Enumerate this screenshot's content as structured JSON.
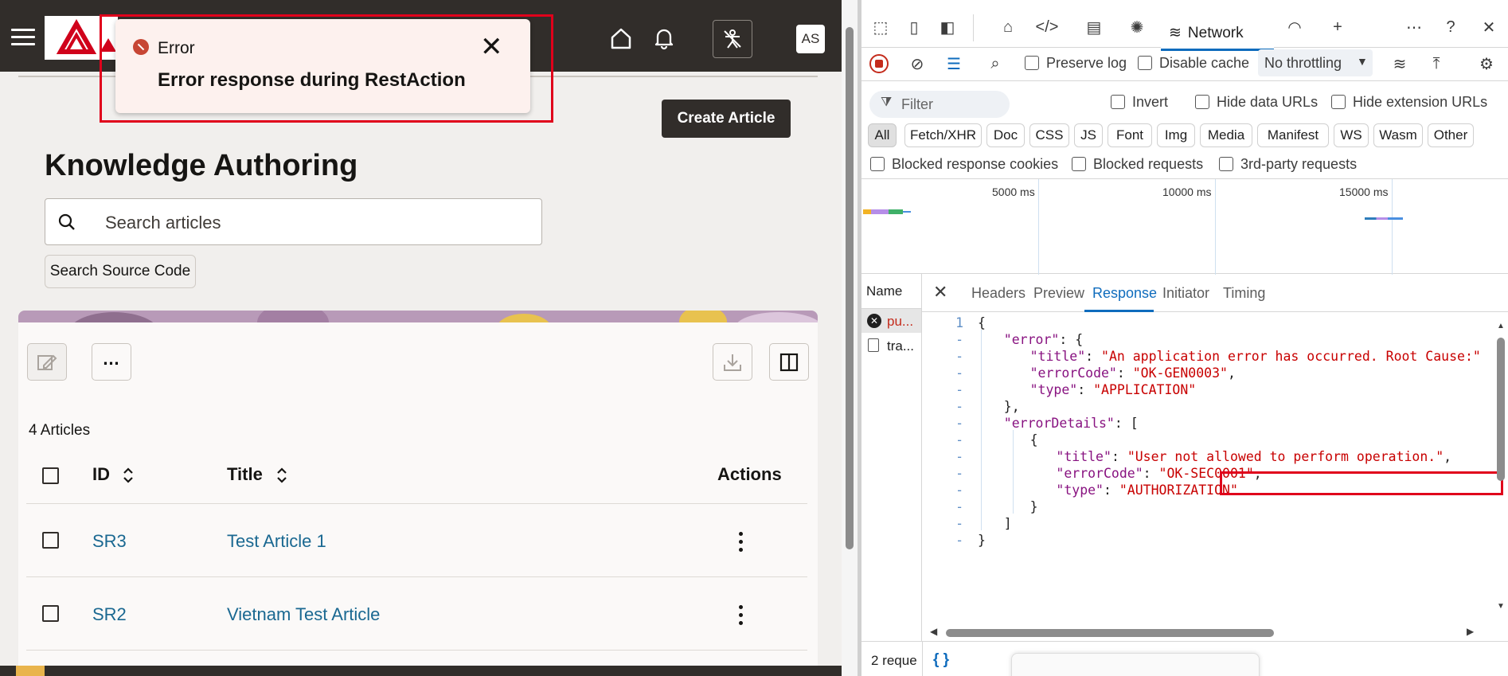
{
  "app": {
    "toast": {
      "title": "Error",
      "message": "Error response during RestAction",
      "close_icon": "close-icon"
    },
    "header": {
      "avatar_initials": "AS",
      "icons": [
        "menu-icon",
        "home-icon",
        "bell-icon",
        "accessibility-icon"
      ]
    },
    "create_button": "Create Article",
    "page_title": "Knowledge Authoring",
    "search": {
      "placeholder": "Search articles"
    },
    "search_source_code": "Search Source Code",
    "article_count": "4 Articles",
    "table": {
      "headers": {
        "id": "ID",
        "title": "Title",
        "actions": "Actions"
      },
      "rows": [
        {
          "id": "SR3",
          "title": "Test Article 1"
        },
        {
          "id": "SR2",
          "title": "Vietnam Test Article"
        }
      ]
    },
    "colors": {
      "header_bg": "#312d2a",
      "link": "#1a6891",
      "error": "#c74634",
      "highlight": "#e0001b"
    }
  },
  "devtools": {
    "active_tool": "Network",
    "toolbar": {
      "preserve_log": "Preserve log",
      "disable_cache": "Disable cache",
      "throttling": "No throttling"
    },
    "filter": {
      "placeholder": "Filter",
      "invert": "Invert",
      "hide_data_urls": "Hide data URLs",
      "hide_extension_urls": "Hide extension URLs"
    },
    "type_filters": [
      "All",
      "Fetch/XHR",
      "Doc",
      "CSS",
      "JS",
      "Font",
      "Img",
      "Media",
      "Manifest",
      "WS",
      "Wasm",
      "Other"
    ],
    "blocked": {
      "cookies": "Blocked response cookies",
      "requests": "Blocked requests",
      "third_party": "3rd-party requests"
    },
    "timeline_labels": [
      "5000 ms",
      "10000 ms",
      "15000 ms"
    ],
    "name_header": "Name",
    "requests": [
      {
        "name": "pu...",
        "failed": true
      },
      {
        "name": "tra...",
        "failed": false
      }
    ],
    "tabs": [
      "Headers",
      "Preview",
      "Response",
      "Initiator",
      "Timing"
    ],
    "active_tab": "Response",
    "response_lines": [
      {
        "n": "1",
        "text": "{"
      },
      {
        "n": "-",
        "key": "error",
        "rest": ": {",
        "indent": 1
      },
      {
        "n": "-",
        "key": "title",
        "val": "An application error has occurred. Root Cause:",
        "tail": "",
        "indent": 2
      },
      {
        "n": "-",
        "key": "errorCode",
        "val": "OK-GEN0003",
        "tail": ",",
        "indent": 2
      },
      {
        "n": "-",
        "key": "type",
        "val": "APPLICATION",
        "tail": "",
        "indent": 2
      },
      {
        "n": "-",
        "text": "},",
        "indent": 1
      },
      {
        "n": "-",
        "key": "errorDetails",
        "rest": ": [",
        "indent": 1
      },
      {
        "n": "-",
        "text": "{",
        "indent": 2
      },
      {
        "n": "-",
        "key": "title",
        "val": "User not allowed to perform operation.",
        "tail": ",",
        "indent": 3
      },
      {
        "n": "-",
        "key": "errorCode",
        "val": "OK-SEC0001",
        "tail": ",",
        "indent": 3
      },
      {
        "n": "-",
        "key": "type",
        "val": "AUTHORIZATION",
        "tail": "",
        "indent": 3
      },
      {
        "n": "-",
        "text": "}",
        "indent": 2
      },
      {
        "n": "-",
        "text": "]",
        "indent": 1
      },
      {
        "n": "-",
        "text": "}"
      }
    ],
    "status_text": "2 reque",
    "format_button": "{ }"
  }
}
